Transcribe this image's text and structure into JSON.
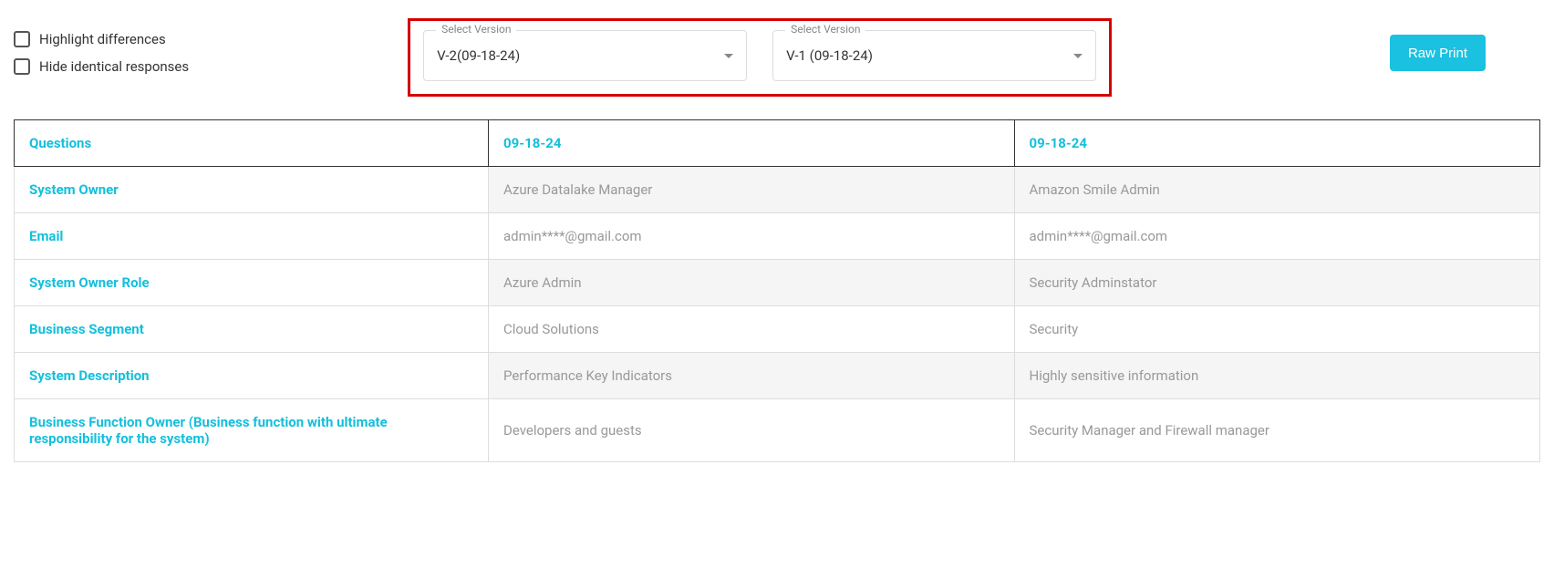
{
  "controls": {
    "highlight_differences_label": "Highlight differences",
    "hide_identical_label": "Hide identical responses"
  },
  "selectors": {
    "float_label": "Select Version",
    "version_a": "V-2(09-18-24)",
    "version_b": "V-1 (09-18-24)"
  },
  "buttons": {
    "raw_print": "Raw Print"
  },
  "table": {
    "headers": {
      "questions": "Questions",
      "col_a": "09-18-24",
      "col_b": "09-18-24"
    },
    "rows": [
      {
        "q": "System Owner",
        "a": "Azure Datalake Manager",
        "b": "Amazon Smile Admin"
      },
      {
        "q": "Email",
        "a": "admin****@gmail.com",
        "b": "admin****@gmail.com"
      },
      {
        "q": "System Owner Role",
        "a": "Azure Admin",
        "b": "Security Adminstator"
      },
      {
        "q": "Business Segment",
        "a": "Cloud Solutions",
        "b": "Security"
      },
      {
        "q": "System Description",
        "a": "Performance Key Indicators",
        "b": "Highly sensitive information"
      },
      {
        "q": "Business Function Owner (Business function with ultimate responsibility for the system)",
        "a": "Developers and guests",
        "b": "Security Manager and Firewall manager"
      }
    ]
  }
}
